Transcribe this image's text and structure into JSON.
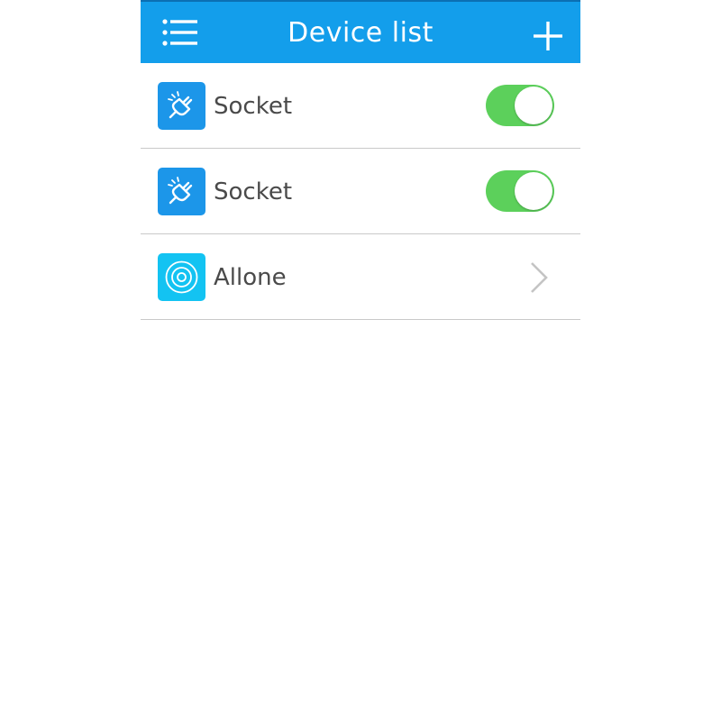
{
  "header": {
    "title": "Device list",
    "menu_icon": "menu-list-icon",
    "add_icon": "plus-icon",
    "background_color": "#139eeb"
  },
  "devices": [
    {
      "label": "Socket",
      "icon": "plug-icon",
      "control": "toggle",
      "state": "on"
    },
    {
      "label": "Socket",
      "icon": "plug-icon",
      "control": "toggle",
      "state": "on"
    },
    {
      "label": "Allone",
      "icon": "concentric-circles-icon",
      "control": "chevron",
      "chevron_icon": "chevron-right-icon"
    }
  ],
  "colors": {
    "toggle_on": "#5cd05b",
    "socket_icon_bg": "#1c96e9",
    "allone_icon_bg": "#13c3f2",
    "label_text": "#4a4a4a",
    "divider": "#c9c9c9"
  }
}
